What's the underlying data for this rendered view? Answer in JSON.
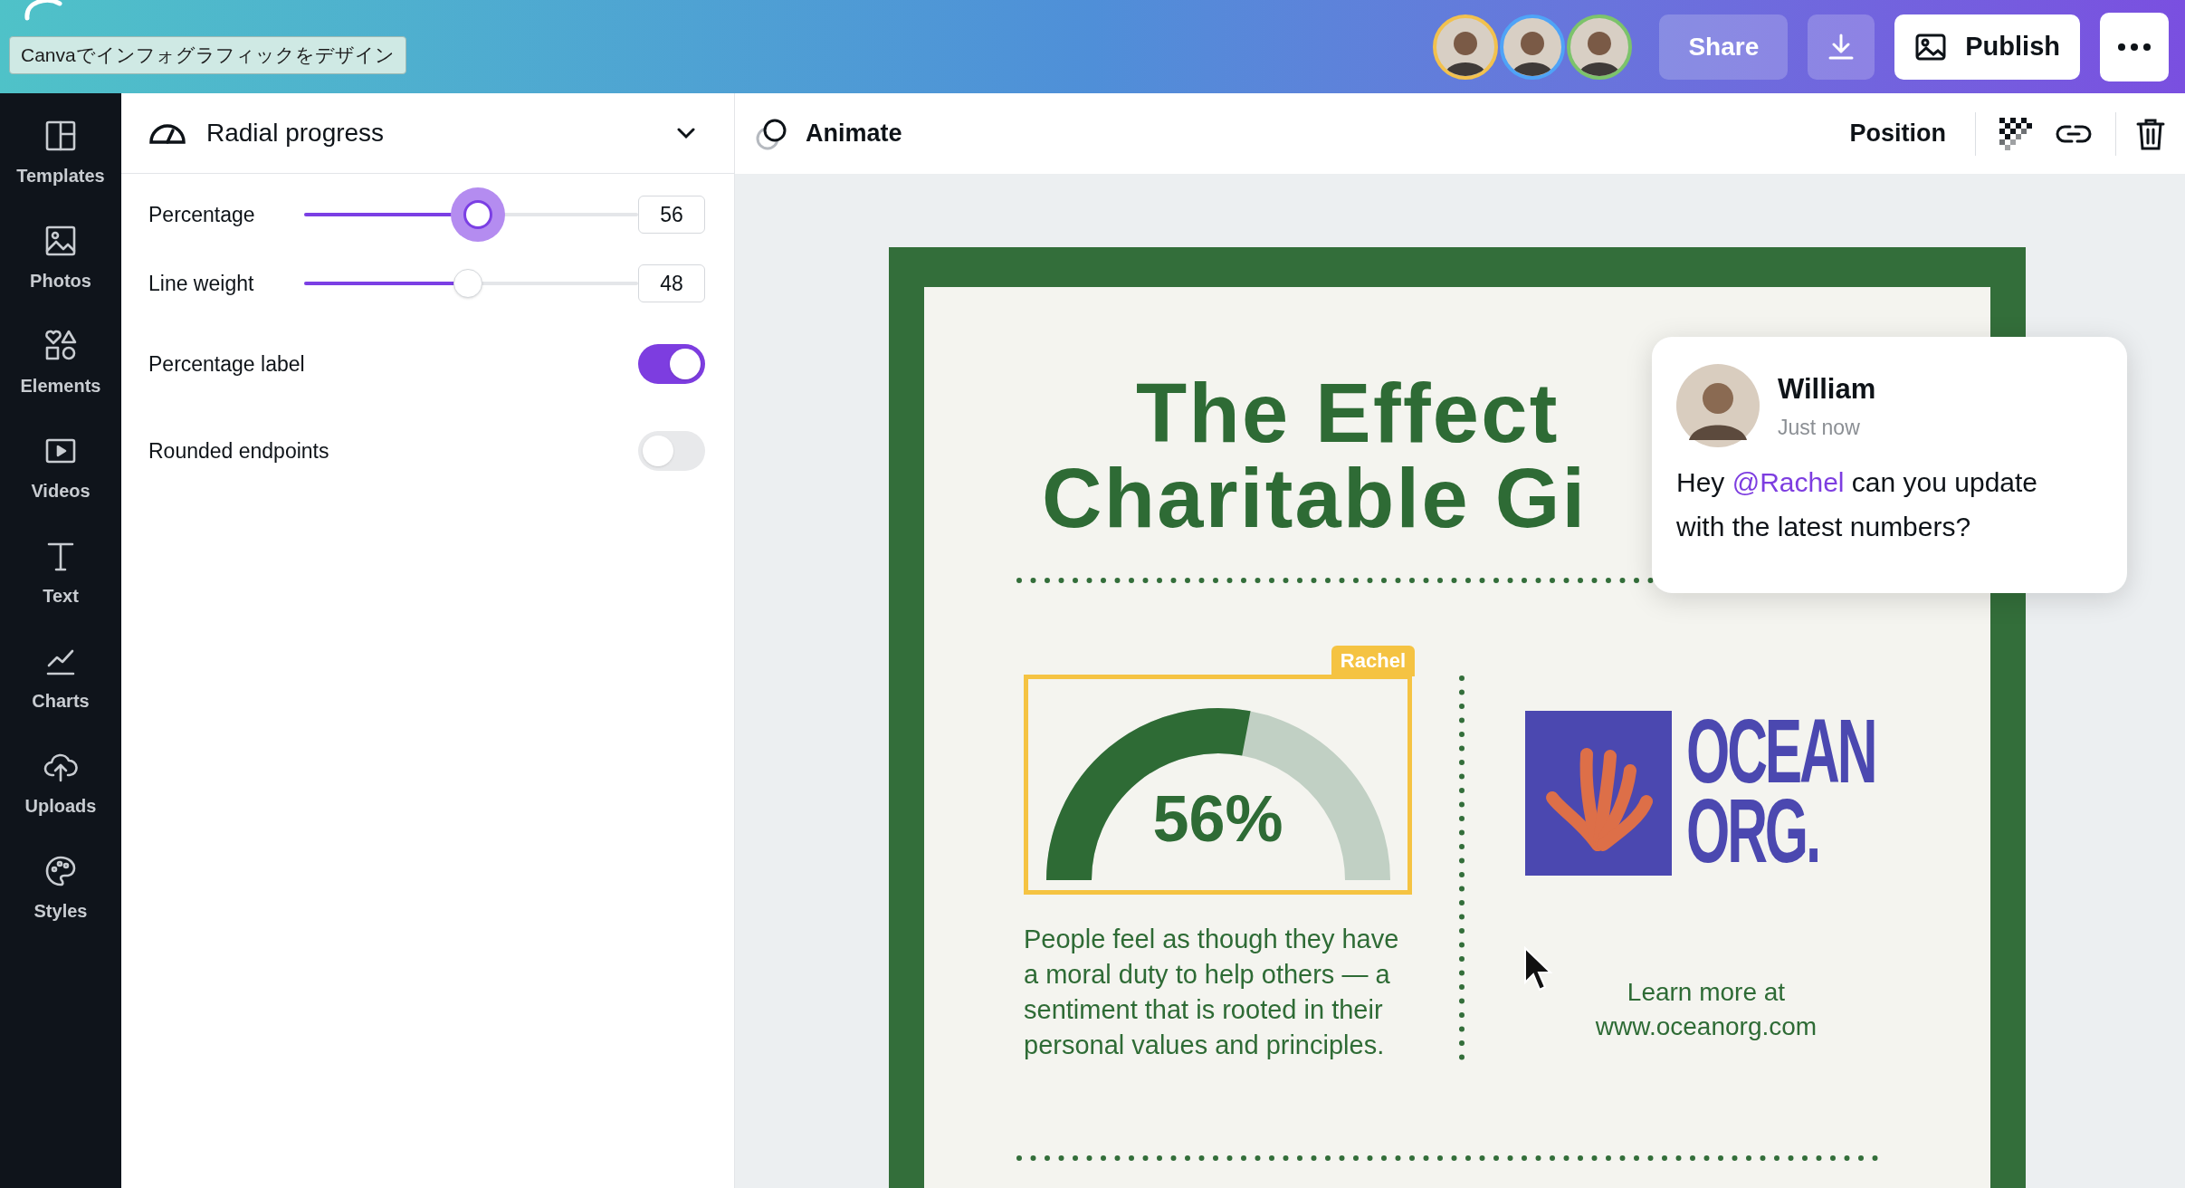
{
  "top_bar": {
    "tooltip": "Canvaでインフォグラフィックをデザイン",
    "collaborators": [
      {
        "color": "#f2c14e"
      },
      {
        "color": "#4fa3f7"
      },
      {
        "color": "#7cc36b"
      }
    ],
    "share": "Share",
    "publish": "Publish"
  },
  "rail": [
    {
      "label": "Templates",
      "kind": "templates"
    },
    {
      "label": "Photos",
      "kind": "photos"
    },
    {
      "label": "Elements",
      "kind": "elements"
    },
    {
      "label": "Videos",
      "kind": "videos"
    },
    {
      "label": "Text",
      "kind": "text"
    },
    {
      "label": "Charts",
      "kind": "charts"
    },
    {
      "label": "Uploads",
      "kind": "uploads"
    },
    {
      "label": "Styles",
      "kind": "styles"
    }
  ],
  "panel": {
    "title": "Radial progress",
    "sliders": [
      {
        "label": "Percentage",
        "level": 0.52,
        "value": "56",
        "focused": true
      },
      {
        "label": "Line weight",
        "level": 0.49,
        "value": "48",
        "focused": false
      }
    ],
    "toggles": [
      {
        "label": "Percentage label",
        "on": true
      },
      {
        "label": "Rounded endpoints",
        "on": false
      }
    ]
  },
  "toolbar": {
    "animate": "Animate",
    "position": "Position"
  },
  "design": {
    "title_lines": [
      "The Effect",
      "Charitable Gi"
    ],
    "gauge": {
      "level": 0.56,
      "label": "56%",
      "tag": "Rachel"
    },
    "paragraph": "People feel as though they have a moral duty to help others — a sentiment that is rooted in their personal values and principles.",
    "logo_lines": [
      "OCEAN",
      "ORG."
    ],
    "learn_more": [
      "Learn more at",
      "www.oceanorg.com"
    ]
  },
  "comment": {
    "author": "William",
    "time": "Just now",
    "message": [
      {
        "kind": "plain",
        "text": "Hey "
      },
      {
        "kind": "mention",
        "text": "@Rachel"
      },
      {
        "kind": "plain",
        "text": " can you update with the latest numbers?"
      }
    ]
  }
}
